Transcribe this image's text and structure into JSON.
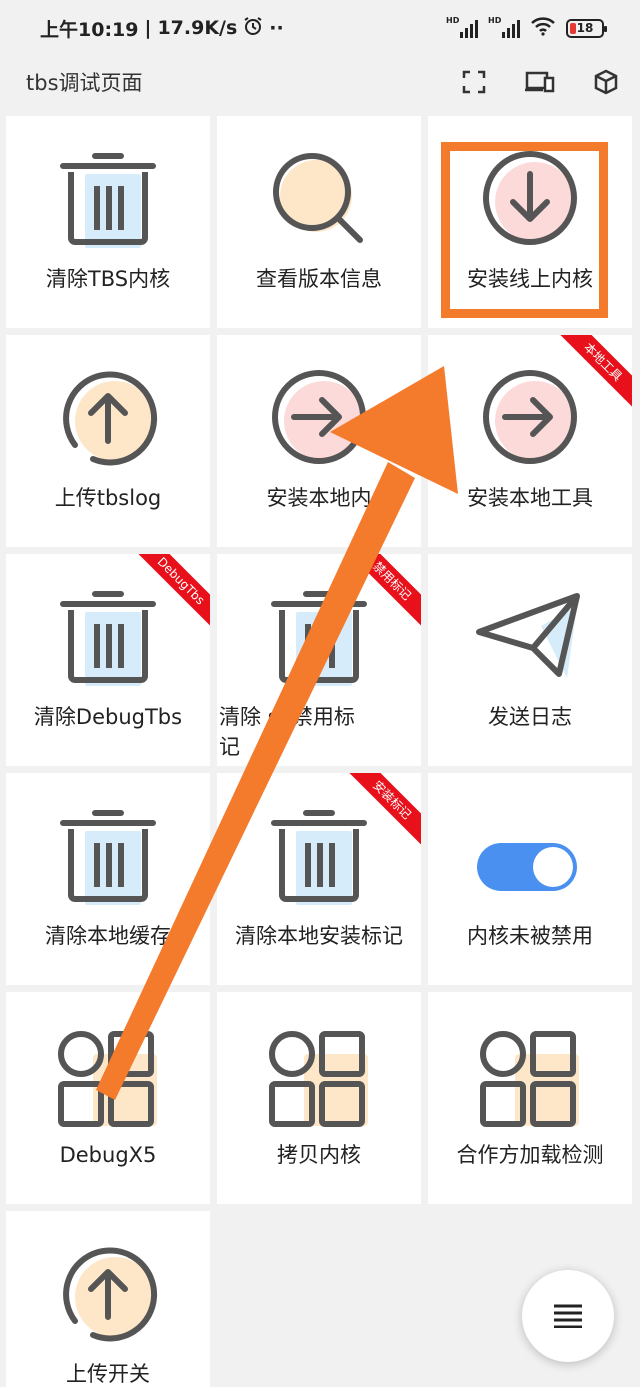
{
  "status_bar": {
    "time": "上午10:19",
    "separator": "|",
    "speed": "17.9K/s",
    "more": "··",
    "hd": "HD",
    "battery": "18"
  },
  "header": {
    "title": "tbs调试页面"
  },
  "grid": {
    "items": [
      {
        "label": "清除TBS内核",
        "icon": "trash-icon",
        "badge_color": "#d6ecfb"
      },
      {
        "label": "查看版本信息",
        "icon": "search-icon",
        "badge_color": "#fde7c8"
      },
      {
        "label": "安装线上内核",
        "icon": "download-circle-icon",
        "badge_color": "#fddada"
      },
      {
        "label": "上传tbslog",
        "icon": "upload-circle-icon",
        "badge_color": "#fde7c8"
      },
      {
        "label": "安装本地内",
        "icon": "arrow-right-circle-icon",
        "badge_color": "#fddada"
      },
      {
        "label": "安装本地工具",
        "icon": "arrow-right-circle-icon",
        "badge_color": "#fddada",
        "ribbon": "本地工具"
      },
      {
        "label": "清除DebugTbs",
        "icon": "trash-icon",
        "badge_color": "#d6ecfb",
        "ribbon": "DebugTbs"
      },
      {
        "label_line1": "清除   sh禁用标",
        "label_line2": "记",
        "icon": "trash-icon",
        "badge_color": "#d6ecfb",
        "ribbon": "禁用标记"
      },
      {
        "label": "发送日志",
        "icon": "paper-plane-icon",
        "badge_color": "#d6ecfb"
      },
      {
        "label": "清除本地缓存",
        "icon": "trash-icon",
        "badge_color": "#d6ecfb"
      },
      {
        "label": "清除本地安装标记",
        "icon": "trash-icon",
        "badge_color": "#d6ecfb",
        "ribbon": "安装标记"
      },
      {
        "label": "内核未被禁用",
        "icon": "toggle-switch-icon",
        "state": "on",
        "accent": "#4a90f0"
      },
      {
        "label": "DebugX5",
        "icon": "grid-apps-icon",
        "badge_color": "#fde7c8"
      },
      {
        "label": "拷贝内核",
        "icon": "grid-apps-icon",
        "badge_color": "#fde7c8"
      },
      {
        "label": "合作方加载检测",
        "icon": "grid-apps-icon",
        "badge_color": "#fde7c8"
      },
      {
        "label": "上传开关",
        "icon": "upload-circle-icon",
        "badge_color": "#fde7c8"
      }
    ]
  },
  "annotation": {
    "arrow_color": "#f47a2c"
  }
}
